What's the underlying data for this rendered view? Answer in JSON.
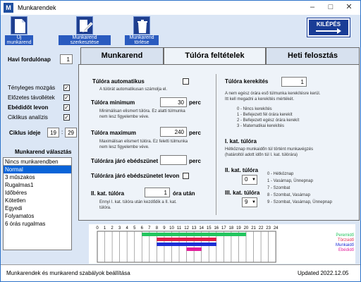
{
  "window": {
    "title": "Munkarendek",
    "app_icon": "M"
  },
  "toolbar": {
    "new_label": "Új munkarend",
    "edit_label": "Munkarend szerkesztése",
    "delete_label": "Munkarend törlése",
    "exit_label": "KILÉPÉS"
  },
  "left": {
    "havi_fordulonap_label": "Havi fordulónap",
    "havi_fordulonap_value": "1",
    "tenyleges_mozgas_label": "Tényleges mozgás",
    "elozetes_tavollet_label": "Előzetes távollétek",
    "ebedidot_levon_label": "Ebédidőt levon",
    "ciklikus_analizis_label": "Ciklikus analízis",
    "ciklus_ideje_label": "Ciklus ideje",
    "ciklus_hour": "19",
    "ciklus_min": "29",
    "colon": ":",
    "valasztas_label": "Munkarend választás",
    "list": [
      "Nincs munkarendben",
      "Normal",
      "3 műszakos",
      "Rugalmas1",
      "Időbéres",
      "Kötetlen",
      "Egyedi",
      "Folyamatos",
      "6 órás rugalmas"
    ]
  },
  "tabs": {
    "munkarend": "Munkarend",
    "tulora": "Túlóra feltételek",
    "heti": "Heti felosztás"
  },
  "panel": {
    "tulora_auto_label": "Túlóra automatikus",
    "tulora_auto_hint": "A túlórát automatikusan számolja el.",
    "tulora_min_label": "Túlóra minimum",
    "tulora_min_value": "30",
    "tulora_min_unit": "perc",
    "tulora_min_hint1": "Minimálisan elismert túlóra. Ez alatti túlmunka",
    "tulora_min_hint2": "nem lesz figyelembe véve.",
    "tulora_max_label": "Túlóra maximum",
    "tulora_max_value": "240",
    "tulora_max_unit": "perc",
    "tulora_max_hint1": "Maximálisan elismert túlóra. Ez feletti túlmunka",
    "tulora_max_hint2": "nem lesz figyelembe véve.",
    "ebedszunet_label": "Túlórára járó ebédszünet",
    "ebedszunet_unit": "perc",
    "ebed_levon_label": "Túlórára járó ebédszünetet levon",
    "ii_kat_label": "II. kat. túlóra",
    "ii_kat_value": "1",
    "ii_kat_unit": "óra után",
    "ii_kat_hint1": "Ennyi  I. kat. túlóra után kezdődik a II. kat.",
    "ii_kat_hint2": "túlóra.",
    "kerekites_label": "Túlóra kerekítés",
    "kerekites_value": "1",
    "kerekites_hint1": "A nem egész órára eső túlmunka kerekítésre kerül.",
    "kerekites_hint2": "Itt kell megadni a kerekítés mértékét.",
    "kerekites_options": [
      "0  -  Nincs kerekítés",
      "1  -  Befejezett fél órára kerekít",
      "2  -  Befejezett egész órára kerekít",
      "3  -  Matematikai kerekítés"
    ],
    "i_kat_label": "I. kat. túlóra",
    "i_kat_hint1": "Hétköznap munkaidőn túl történt munkavégzés",
    "i_kat_hint2": "(határoltól adott időn túl I. kat. túlórára)",
    "ii_kat_r_label": "II. kat. túlóra",
    "ii_kat_r_value": "0",
    "iii_kat_label": "III. kat. túlóra",
    "iii_kat_value": "9",
    "day_options": [
      "0  -  Hétköznap",
      "1  -  Vasárnap, Ünnepnap",
      "7  -  Szombat",
      "8  -  Szombat, Vasárnap",
      "9  -  Szombat, Vasárnap, Ünnepnap"
    ]
  },
  "timeline": {
    "hours": [
      "0",
      "1",
      "2",
      "3",
      "4",
      "5",
      "6",
      "7",
      "8",
      "9",
      "10",
      "11",
      "12",
      "13",
      "14",
      "15",
      "16",
      "17",
      "18",
      "19",
      "20",
      "21",
      "22",
      "23",
      "24"
    ],
    "legend": [
      "Peremidő",
      "Törzsidő",
      "Munkaidő",
      "Ebédidő"
    ],
    "colors": {
      "peremido": "#22c55e",
      "torzsido": "#e11d48",
      "munkaido": "#1d2fd6",
      "ebedido": "#e11d9b"
    },
    "ranges": {
      "peremido": [
        6,
        20
      ],
      "torzsido": [
        8,
        16
      ],
      "munkaido": [
        8,
        16
      ],
      "ebedido": [
        12,
        14
      ]
    }
  },
  "status": {
    "text": "Munkarendek és munkarend szabályok beállítása",
    "updated": "Updated  2022.12.05"
  }
}
